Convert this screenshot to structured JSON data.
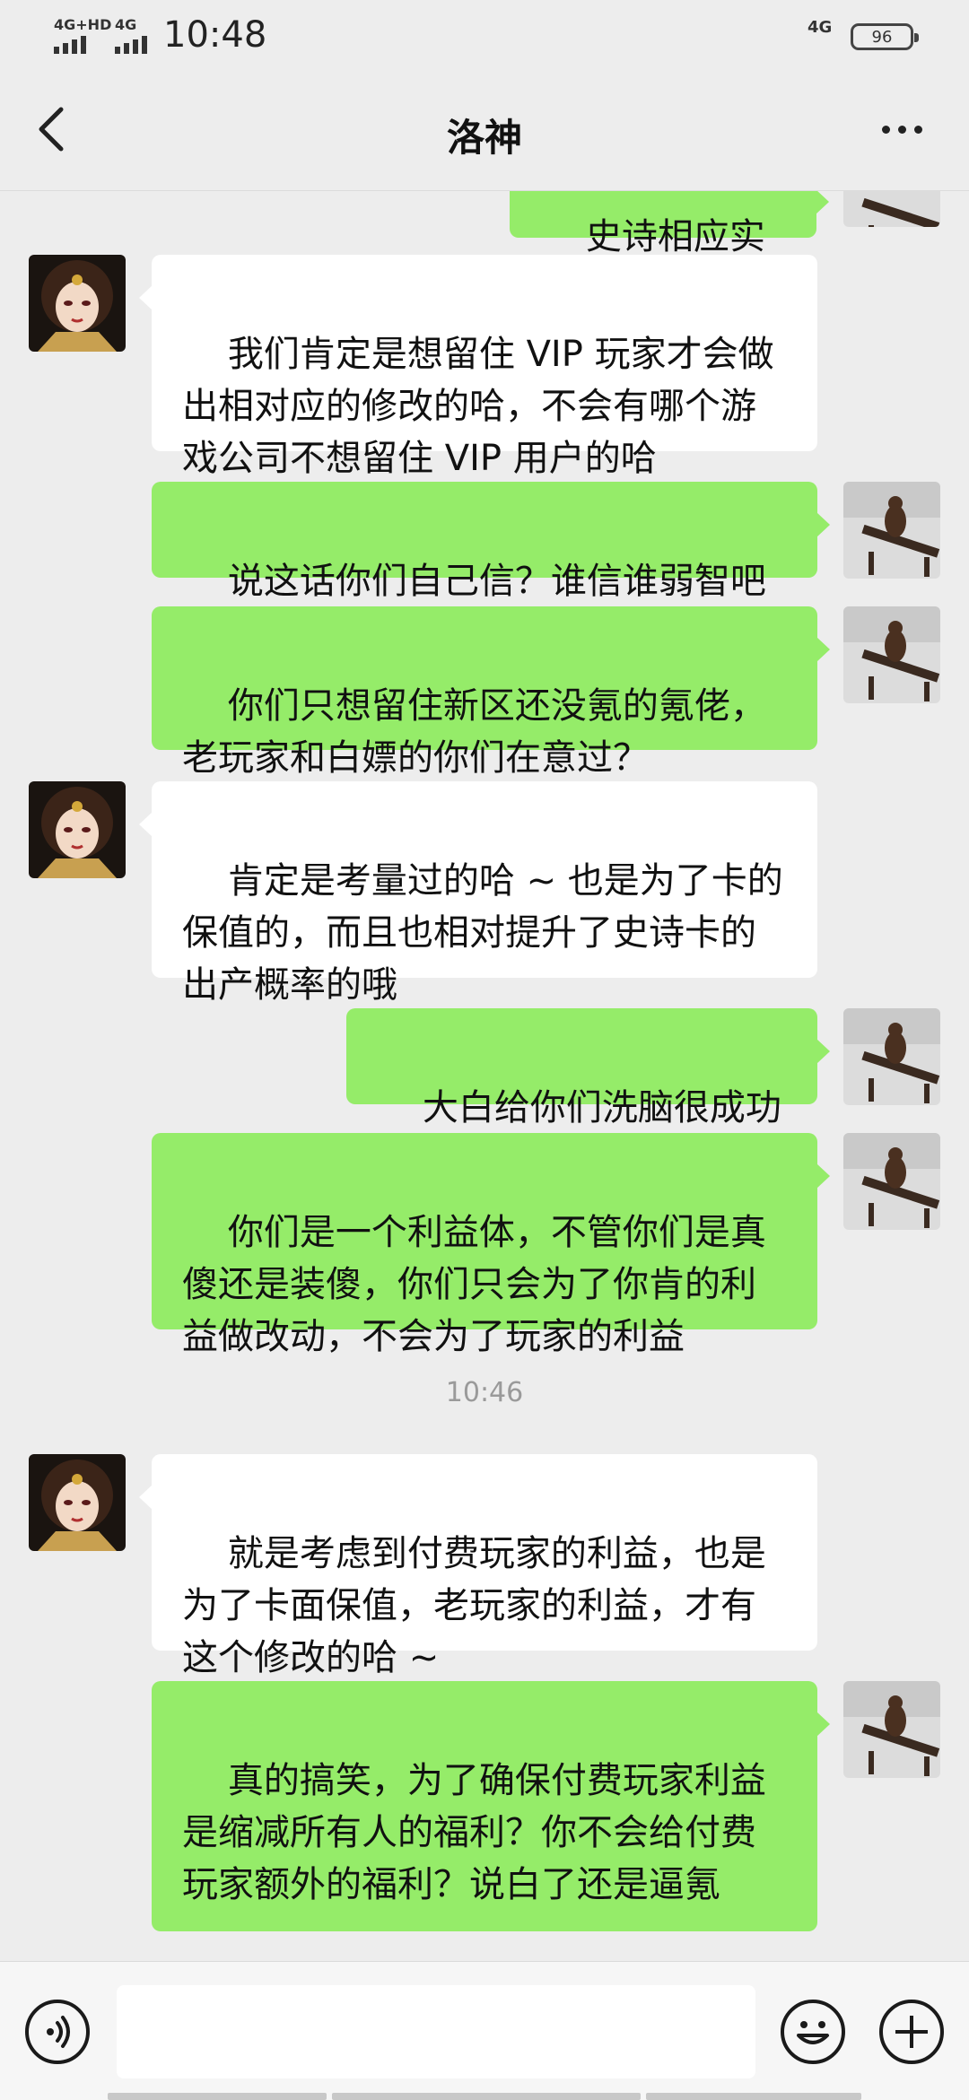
{
  "status_bar": {
    "signal1_label": "4G+HD",
    "signal2_label": "4G",
    "time": "10:48",
    "network": "4G",
    "battery": "96"
  },
  "header": {
    "title": "洛神",
    "back_icon": "chevron-left-icon",
    "more_icon": "more-dots-icon"
  },
  "messages": [
    {
      "sender": "self",
      "text": "史诗相应实在"
    },
    {
      "sender": "other",
      "text": "我们肯定是想留住 VIP 玩家才会做出相对应的修改的哈，不会有哪个游戏公司不想留住 VIP 用户的哈"
    },
    {
      "sender": "self",
      "text": "说这话你们自己信？谁信谁弱智吧"
    },
    {
      "sender": "self",
      "text": "你们只想留住新区还没氪的氪佬，老玩家和白嫖的你们在意过？"
    },
    {
      "sender": "other",
      "text": "肯定是考量过的哈 ~ 也是为了卡的保值的，而且也相对提升了史诗卡的出产概率的哦"
    },
    {
      "sender": "self",
      "text": "大白给你们洗脑很成功"
    },
    {
      "sender": "self",
      "text": "你们是一个利益体，不管你们是真傻还是装傻，你们只会为了你肯的利益做改动，不会为了玩家的利益"
    },
    {
      "sender": "other",
      "text": "就是考虑到付费玩家的利益，也是为了卡面保值，老玩家的利益，才有这个修改的哈 ~"
    },
    {
      "sender": "self",
      "text": "真的搞笑，为了确保付费玩家利益是缩减所有人的福利？你不会给付费玩家额外的福利？说白了还是逼氪"
    }
  ],
  "timestamp": "10:46",
  "input_bar": {
    "voice_icon": "voice-icon",
    "emoji_icon": "emoji-icon",
    "plus_icon": "plus-icon"
  },
  "colors": {
    "sent_bubble": "#95ec69",
    "received_bubble": "#ffffff",
    "background": "#ededed"
  }
}
